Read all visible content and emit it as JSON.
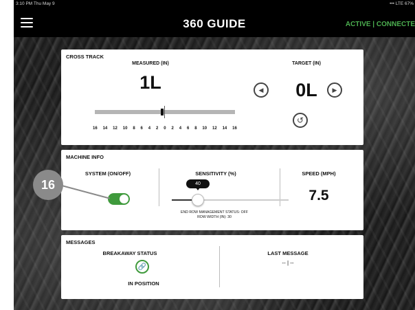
{
  "status_bar": {
    "time": "3:10 PM  Thu May 9",
    "right": "••• LTE 67%"
  },
  "header": {
    "title": "360 GUIDE",
    "connection_status": "ACTIVE | CONNECTE",
    "menu_icon": "hamburger-menu-icon"
  },
  "cross_track": {
    "header": "CROSS TRACK",
    "measured_label": "MEASURED (IN)",
    "measured_value": "1L",
    "target_label": "TARGET (IN)",
    "target_value": "0L",
    "scale_labels": [
      "16",
      "14",
      "12",
      "10",
      "8",
      "6",
      "4",
      "2",
      "0",
      "2",
      "4",
      "6",
      "8",
      "10",
      "12",
      "14",
      "16"
    ]
  },
  "machine_info": {
    "header": "MACHINE INFO",
    "system_label": "SYSTEM (ON/OFF)",
    "system_on": true,
    "sensitivity_label": "SENSITIVITY (%)",
    "sensitivity_value": "40",
    "speed_label": "SPEED (MPH)",
    "speed_value": "7.5",
    "end_row_status": "END ROW MANAGEMENT STATUS: OFF",
    "row_width": "ROW WIDTH (IN): 30"
  },
  "callout": {
    "number": "16"
  },
  "messages": {
    "header": "MESSAGES",
    "breakaway_label": "BREAKAWAY STATUS",
    "breakaway_icon": "link-icon",
    "breakaway_status": "IN POSITION",
    "last_message_label": "LAST MESSAGE",
    "last_message_value": "-- | --"
  },
  "colors": {
    "accent_green": "#3f9a3c",
    "callout_gray": "#8a8a8a",
    "status_green": "#4caf50"
  }
}
